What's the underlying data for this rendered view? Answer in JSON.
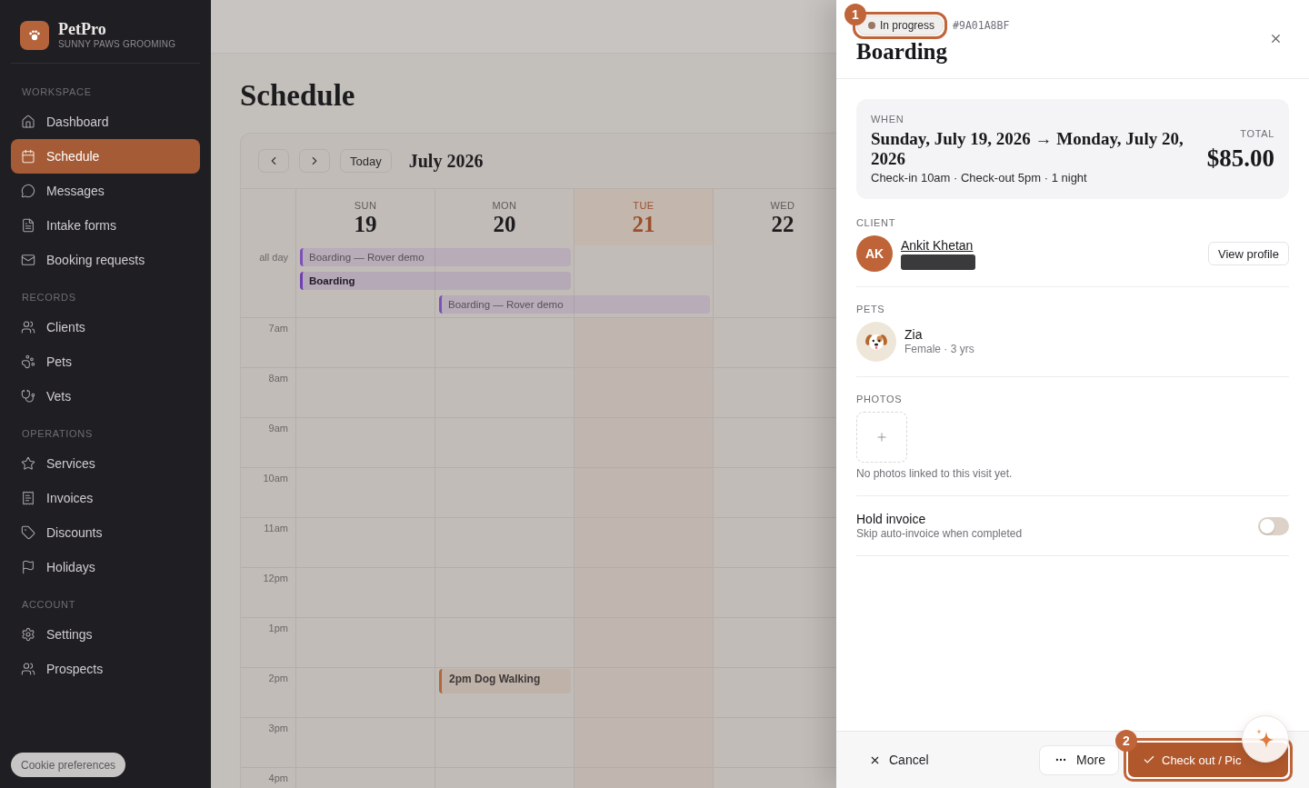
{
  "sidebar": {
    "brand": {
      "name": "PetPro",
      "subtitle": "SUNNY PAWS GROOMING"
    },
    "sections": [
      {
        "title": "WORKSPACE",
        "items": [
          {
            "label": "Dashboard",
            "selected": false
          },
          {
            "label": "Schedule",
            "selected": true
          },
          {
            "label": "Messages",
            "selected": false
          },
          {
            "label": "Intake forms",
            "selected": false
          },
          {
            "label": "Booking requests",
            "selected": false
          }
        ]
      },
      {
        "title": "RECORDS",
        "items": [
          {
            "label": "Clients",
            "selected": false
          },
          {
            "label": "Pets",
            "selected": false
          },
          {
            "label": "Vets",
            "selected": false
          }
        ]
      },
      {
        "title": "OPERATIONS",
        "items": [
          {
            "label": "Services",
            "selected": false
          },
          {
            "label": "Invoices",
            "selected": false
          },
          {
            "label": "Discounts",
            "selected": false
          },
          {
            "label": "Holidays",
            "selected": false
          }
        ]
      },
      {
        "title": "ACCOUNT",
        "items": [
          {
            "label": "Settings",
            "selected": false
          },
          {
            "label": "Prospects",
            "selected": false
          }
        ]
      }
    ],
    "cookie_button": "Cookie preferences"
  },
  "page": {
    "title": "Schedule"
  },
  "calendar": {
    "today_button": "Today",
    "month": "July 2026",
    "days": [
      {
        "weekday": "SUN",
        "date": "19",
        "today": false
      },
      {
        "weekday": "MON",
        "date": "20",
        "today": false
      },
      {
        "weekday": "TUE",
        "date": "21",
        "today": true
      },
      {
        "weekday": "WED",
        "date": "22",
        "today": false
      }
    ],
    "all_day": {
      "label": "all day",
      "events": [
        {
          "title": "Boarding — Rover demo",
          "covers": [
            true,
            true,
            false,
            false
          ],
          "selected": false,
          "color": "#7d52b8"
        },
        {
          "title": "Boarding",
          "covers": [
            true,
            true,
            false,
            false
          ],
          "selected": true,
          "color": "#6f3fb3"
        },
        {
          "title": "Boarding — Rover demo",
          "covers": [
            false,
            true,
            true,
            false
          ],
          "selected": false,
          "color": "#7d52b8"
        }
      ]
    },
    "hours": [
      {
        "label": "7am"
      },
      {
        "label": "8am"
      },
      {
        "label": "9am"
      },
      {
        "label": "10am"
      },
      {
        "label": "11am"
      },
      {
        "label": "12pm"
      },
      {
        "label": "1pm"
      },
      {
        "label": "2pm",
        "events": [
          {
            "title": "2pm Dog Walking",
            "covers": [
              false,
              true,
              false,
              false
            ],
            "selected": false,
            "color": "#b0683e"
          }
        ]
      },
      {
        "label": "3pm"
      },
      {
        "label": "4pm"
      }
    ]
  },
  "detail_panel": {
    "status": {
      "label": "In progress",
      "callout": "1"
    },
    "reference": "#9A01A8BF",
    "title": "Boarding",
    "when": {
      "label": "WHEN",
      "range": "Sunday, July 19, 2026 → Monday, July 20, 2026",
      "details": "Check-in 10am · Check-out 5pm · 1 night",
      "total_label": "TOTAL",
      "total": "$85.00"
    },
    "client": {
      "label": "CLIENT",
      "initials": "AK",
      "name": "Ankit Khetan",
      "button": "View profile"
    },
    "pets": {
      "label": "PETS",
      "items": [
        {
          "name": "Zia",
          "details": "Female · 3 yrs"
        }
      ]
    },
    "photos": {
      "label": "PHOTOS",
      "empty_text": "No photos linked to this visit yet."
    },
    "hold_invoice": {
      "title": "Hold invoice",
      "description": "Skip auto-invoice when completed",
      "on": false
    },
    "footer": {
      "cancel": "Cancel",
      "more": "More",
      "primary": {
        "label": "Check out / Pic",
        "callout": "2"
      }
    }
  }
}
